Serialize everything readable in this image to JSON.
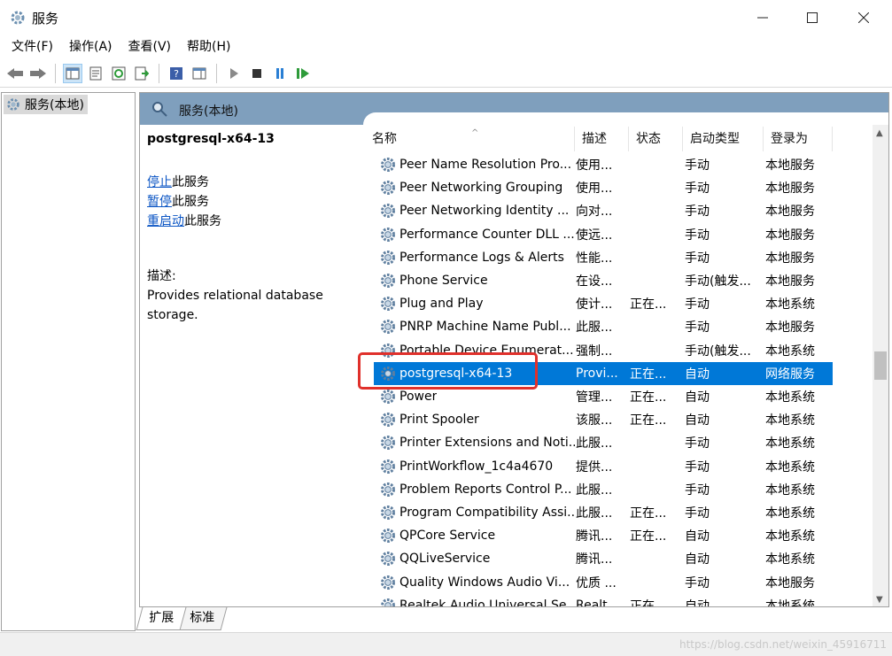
{
  "window": {
    "title": "服务"
  },
  "menu": [
    "文件(F)",
    "操作(A)",
    "查看(V)",
    "帮助(H)"
  ],
  "tree": {
    "root_label": "服务(本地)"
  },
  "pane": {
    "header_title": "服务(本地)",
    "service_name": "postgresql-x64-13",
    "actions": [
      {
        "link": "停止",
        "suffix": "此服务"
      },
      {
        "link": "暂停",
        "suffix": "此服务"
      },
      {
        "link": "重启动",
        "suffix": "此服务"
      }
    ],
    "desc_label": "描述:",
    "desc_text": "Provides relational database storage."
  },
  "columns": [
    "名称",
    "描述",
    "状态",
    "启动类型",
    "登录为"
  ],
  "rows": [
    {
      "name": "Peer Name Resolution Pro...",
      "desc": "使用...",
      "status": "",
      "startup": "手动",
      "logon": "本地服务"
    },
    {
      "name": "Peer Networking Grouping",
      "desc": "使用...",
      "status": "",
      "startup": "手动",
      "logon": "本地服务"
    },
    {
      "name": "Peer Networking Identity ...",
      "desc": "向对...",
      "status": "",
      "startup": "手动",
      "logon": "本地服务"
    },
    {
      "name": "Performance Counter DLL ...",
      "desc": "使远...",
      "status": "",
      "startup": "手动",
      "logon": "本地服务"
    },
    {
      "name": "Performance Logs & Alerts",
      "desc": "性能...",
      "status": "",
      "startup": "手动",
      "logon": "本地服务"
    },
    {
      "name": "Phone Service",
      "desc": "在设...",
      "status": "",
      "startup": "手动(触发...",
      "logon": "本地服务"
    },
    {
      "name": "Plug and Play",
      "desc": "使计...",
      "status": "正在...",
      "startup": "手动",
      "logon": "本地系统"
    },
    {
      "name": "PNRP Machine Name Publ...",
      "desc": "此服...",
      "status": "",
      "startup": "手动",
      "logon": "本地服务"
    },
    {
      "name": "Portable Device Enumerat...",
      "desc": "强制...",
      "status": "",
      "startup": "手动(触发...",
      "logon": "本地系统"
    },
    {
      "name": "postgresql-x64-13",
      "desc": "Provi...",
      "status": "正在...",
      "startup": "自动",
      "logon": "网络服务",
      "selected": true
    },
    {
      "name": "Power",
      "desc": "管理...",
      "status": "正在...",
      "startup": "自动",
      "logon": "本地系统"
    },
    {
      "name": "Print Spooler",
      "desc": "该服...",
      "status": "正在...",
      "startup": "自动",
      "logon": "本地系统"
    },
    {
      "name": "Printer Extensions and Noti...",
      "desc": "此服...",
      "status": "",
      "startup": "手动",
      "logon": "本地系统"
    },
    {
      "name": "PrintWorkflow_1c4a4670",
      "desc": "提供...",
      "status": "",
      "startup": "手动",
      "logon": "本地系统"
    },
    {
      "name": "Problem Reports Control P...",
      "desc": "此服...",
      "status": "",
      "startup": "手动",
      "logon": "本地系统"
    },
    {
      "name": "Program Compatibility Assi...",
      "desc": "此服...",
      "status": "正在...",
      "startup": "手动",
      "logon": "本地系统"
    },
    {
      "name": "QPCore Service",
      "desc": "腾讯...",
      "status": "正在...",
      "startup": "自动",
      "logon": "本地系统"
    },
    {
      "name": "QQLiveService",
      "desc": "腾讯...",
      "status": "",
      "startup": "自动",
      "logon": "本地系统"
    },
    {
      "name": "Quality Windows Audio Vi...",
      "desc": "优质 ...",
      "status": "",
      "startup": "手动",
      "logon": "本地服务"
    },
    {
      "name": "Realtek Audio Universal Se...",
      "desc": "Realt...",
      "status": "正在...",
      "startup": "自动",
      "logon": "本地系统"
    }
  ],
  "tabs": [
    "扩展",
    "标准"
  ],
  "watermark": "https://blog.csdn.net/weixin_45916711",
  "colors": {
    "selection": "#0078d7",
    "header": "#7f9fbd",
    "highlight_box": "#e0302b",
    "link": "#0b55c4"
  }
}
